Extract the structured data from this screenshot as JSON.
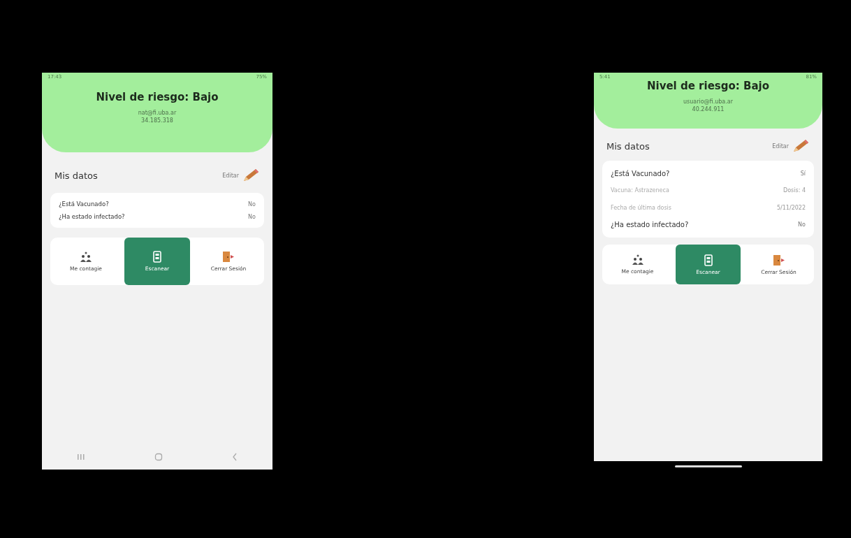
{
  "phones": [
    {
      "kind": "buttons",
      "status_bar": {
        "time": "17:43",
        "indicators": "75%"
      },
      "header": {
        "title": "Nivel de riesgo: Bajo",
        "email": "nat@fi.uba.ar",
        "id": "34.185.318"
      },
      "section_title": "Mis datos",
      "edit_label": "Editar",
      "rows": [
        {
          "kind": "question",
          "label": "¿Está Vacunado?",
          "value": "No"
        },
        {
          "kind": "question",
          "label": "¿Ha estado infectado?",
          "value": "No"
        }
      ],
      "actions": [
        {
          "kind": "contagion",
          "label": "Me contagie",
          "selected": false
        },
        {
          "kind": "scan",
          "label": "Escanear",
          "selected": true
        },
        {
          "kind": "logout",
          "label": "Cerrar Sesión",
          "selected": false
        }
      ]
    },
    {
      "kind": "gesture",
      "status_bar": {
        "time": "5:41",
        "indicators": "81%"
      },
      "header": {
        "title": "Nivel de riesgo: Bajo",
        "email": "usuario@fi.uba.ar",
        "id": "40.244.911"
      },
      "section_title": "Mis datos",
      "edit_label": "Editar",
      "rows": [
        {
          "kind": "question",
          "label": "¿Está Vacunado?",
          "value": "Sí"
        },
        {
          "kind": "detail",
          "label": "Vacuna: Astrazeneca",
          "value": "Dosis: 4"
        },
        {
          "kind": "detail",
          "label": "Fecha de última dosis",
          "value": "5/11/2022"
        },
        {
          "kind": "question",
          "label": "¿Ha estado infectado?",
          "value": "No"
        }
      ],
      "actions": [
        {
          "kind": "contagion",
          "label": "Me contagie",
          "selected": false
        },
        {
          "kind": "scan",
          "label": "Escanear",
          "selected": true
        },
        {
          "kind": "logout",
          "label": "Cerrar Sesión",
          "selected": false
        }
      ]
    }
  ]
}
